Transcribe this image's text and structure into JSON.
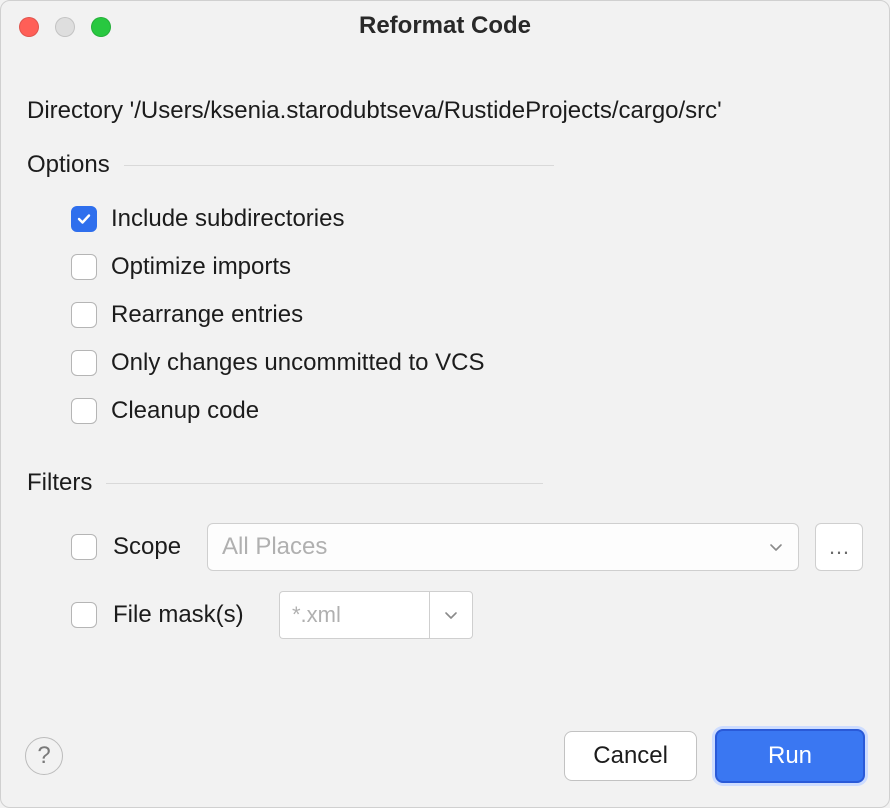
{
  "title": "Reformat Code",
  "directory_line": "Directory '/Users/ksenia.starodubtseva/RustideProjects/cargo/src'",
  "sections": {
    "options_label": "Options",
    "filters_label": "Filters"
  },
  "options": {
    "items": [
      {
        "label": "Include subdirectories",
        "checked": true
      },
      {
        "label": "Optimize imports",
        "checked": false
      },
      {
        "label": "Rearrange entries",
        "checked": false
      },
      {
        "label": "Only changes uncommitted to VCS",
        "checked": false
      },
      {
        "label": "Cleanup code",
        "checked": false
      }
    ]
  },
  "filters": {
    "scope_label": "Scope",
    "scope_placeholder": "All Places",
    "scope_checked": false,
    "ellipsis": "…",
    "file_mask_label": "File mask(s)",
    "file_mask_placeholder": "*.xml",
    "file_mask_checked": false
  },
  "footer": {
    "help": "?",
    "cancel": "Cancel",
    "run": "Run"
  }
}
